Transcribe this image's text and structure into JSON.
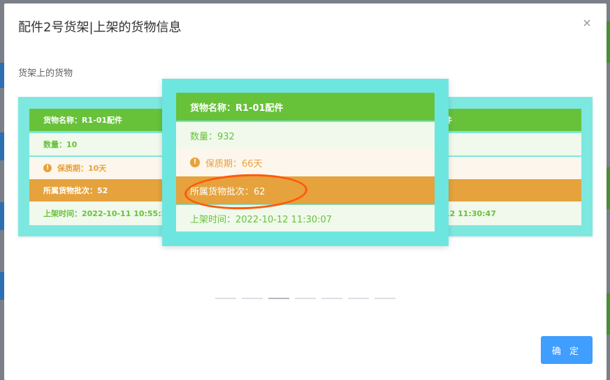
{
  "dialog": {
    "title": "配件2号货架|上架的货物信息",
    "close_icon": "×",
    "section_label": "货架上的货物",
    "confirm_label": "确 定"
  },
  "cards": {
    "left": {
      "name": "货物名称：R1-01配件",
      "quantity": "数量：10",
      "shelf_life": "保质期：10天",
      "batch": "所属货物批次：52",
      "time": "上架时间：2022-10-11 10:55:21"
    },
    "main": {
      "name": "货物名称：R1-01配件",
      "quantity": "数量：932",
      "shelf_life": "保质期：66天",
      "batch": "所属货物批次：62",
      "time": "上架时间：2022-10-12 11:30:07"
    },
    "right": {
      "name_tail": "件",
      "time_tail": "12 11:30:47"
    }
  },
  "carousel": {
    "indicator_count": 7,
    "active_index": 2
  },
  "colors": {
    "accent": "#409eff",
    "success": "#67c23a",
    "warning": "#e6a23c",
    "card_bg": "#6ee6e0",
    "annotation": "#ff5a0a"
  }
}
